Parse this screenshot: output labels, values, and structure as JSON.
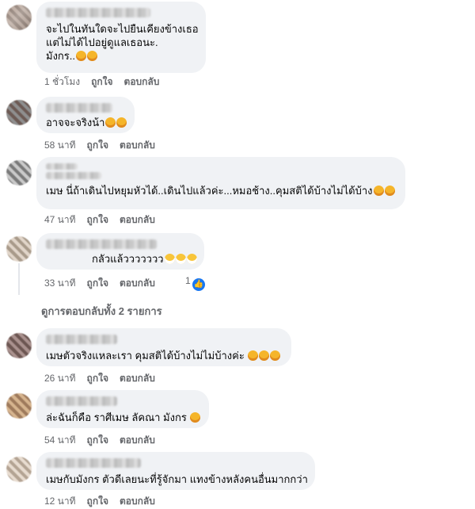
{
  "comments": [
    {
      "lines": [
        "จะไปในทันใดจะไปยืนเคียงข้างเธอ",
        "แต่ไม่ได้ไปอยู่ดูแลเธอนะ.",
        "มังกร.."
      ],
      "emoji": [
        "laugh",
        "laugh"
      ],
      "time": "1 ชั่วโมง",
      "like": "ถูกใจ",
      "reply": "ตอบกลับ"
    },
    {
      "lines": [
        "อาจจะจริงน้า"
      ],
      "emoji": [
        "laugh",
        "laugh"
      ],
      "time": "58 นาที",
      "like": "ถูกใจ",
      "reply": "ตอบกลับ"
    },
    {
      "lines": [
        "เมษ นี่ถ้าเดินไปหยุมหัวได้..เดินไปแล้วค่ะ...หมอช้าง..คุมสติได้บ้างไม่ได้บ้าง"
      ],
      "emoji": [
        "laugh",
        "laugh"
      ],
      "time": "47 นาที",
      "like": "ถูกใจ",
      "reply": "ตอบกลับ"
    },
    {
      "lines": [
        "กลัวแล้ววววววว"
      ],
      "emoji": [
        "grin",
        "grin",
        "grin"
      ],
      "time": "33 นาที",
      "like": "ถูกใจ",
      "reply": "ตอบกลับ",
      "reaction_count": "1"
    },
    {
      "lines": [
        "เมษตัวจริงแหละเรา คุมสติได้บ้างไม่ไม่บ้างค่ะ"
      ],
      "emoji": [
        "laugh",
        "laugh",
        "laugh"
      ],
      "time": "26 นาที",
      "like": "ถูกใจ",
      "reply": "ตอบกลับ"
    },
    {
      "lines": [
        "ล่ะฉันก็คือ ราศีเมษ ลัคณา มังกร"
      ],
      "emoji": [
        "laugh"
      ],
      "time": "54 นาที",
      "like": "ถูกใจ",
      "reply": "ตอบกลับ"
    },
    {
      "lines": [
        "เมษกับมังกร ตัวดีเลยนะที่รู้จักมา แทงข้างหลังคนอื่นมากกว่า"
      ],
      "emoji": [],
      "time": "12 นาที",
      "like": "ถูกใจ",
      "reply": "ตอบกลับ"
    }
  ],
  "more_replies": "ดูการตอบกลับทั้ง 2 รายการ",
  "colors": {
    "bubble": "#f0f2f5",
    "meta": "#65676b",
    "like_blue": "#1877f2"
  }
}
